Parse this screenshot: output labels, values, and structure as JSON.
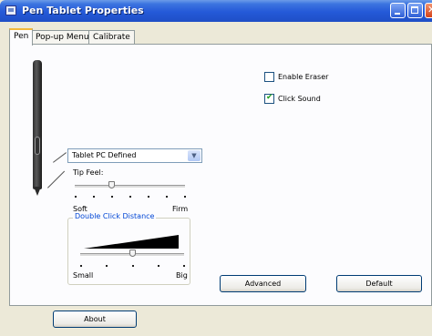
{
  "window": {
    "title": "Pen Tablet Properties"
  },
  "tabs": [
    {
      "label": "Pen"
    },
    {
      "label": "Pop-up Menu"
    },
    {
      "label": "Calibrate"
    }
  ],
  "pen_settings": {
    "side_switch_value": "Tablet PC Defined",
    "tip_feel": {
      "label": "Tip Feel:",
      "min_label": "Soft",
      "max_label": "Firm",
      "ticks": 7,
      "level_fraction": 0.33
    },
    "double_click": {
      "legend": "Double Click Distance",
      "min_label": "Small",
      "max_label": "Big",
      "ticks": 5,
      "level_fraction": 0.5
    }
  },
  "options": {
    "enable_eraser": {
      "label": "Enable Eraser",
      "checked": false
    },
    "click_sound": {
      "label": "Click Sound",
      "checked": true
    }
  },
  "buttons": {
    "advanced": "Advanced",
    "default": "Default",
    "about": "About"
  },
  "icons": {
    "app": "tablet-icon",
    "dropdown": "chevron-down-icon",
    "check": "checkmark-icon"
  },
  "colors": {
    "titlebar": "#245edb",
    "accent_tab": "#f2b93b",
    "group_legend": "#0046d5",
    "check": "#21a121"
  }
}
